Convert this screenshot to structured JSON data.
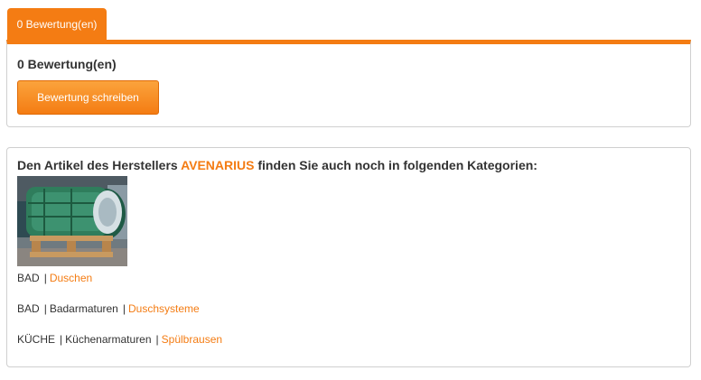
{
  "tabs": [
    {
      "label": "0 Bewertung(en)"
    }
  ],
  "reviews": {
    "count_label": "0 Bewertung(en)",
    "write_button": "Bewertung schreiben"
  },
  "manufacturer": {
    "heading_prefix": "Den Artikel des Herstellers",
    "brand": "AVENARIUS",
    "heading_suffix": "finden Sie auch noch in folgenden Kategorien:",
    "categories": [
      {
        "level1": "BAD",
        "link": "Duschen"
      },
      {
        "level1": "BAD",
        "level2": "Badarmaturen",
        "link": "Duschsysteme"
      },
      {
        "level1": "KÜCHE",
        "level2": "Küchenarmaturen",
        "link": "Spülbrausen"
      }
    ]
  },
  "colors": {
    "accent": "#f47c13",
    "border": "#cfcfcf",
    "text": "#333333"
  }
}
